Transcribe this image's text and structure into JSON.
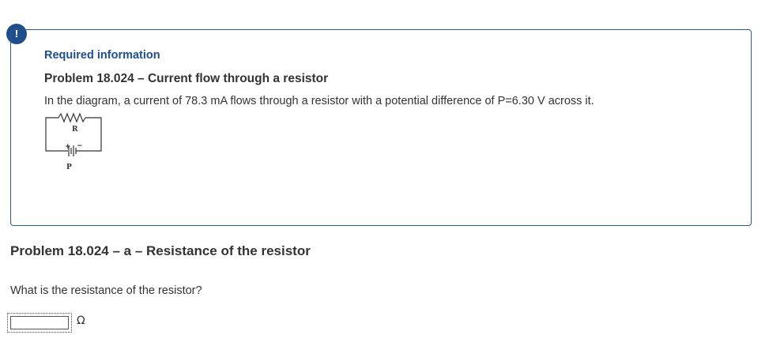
{
  "alert": {
    "icon": "exclamation-icon",
    "symbol": "!"
  },
  "info_box": {
    "heading": "Required information",
    "problem_title": "Problem 18.024 – Current flow through a resistor",
    "description": "In the diagram, a current of 78.3 mA flows through a resistor with a potential difference of  P=6.30 V across it.",
    "diagram": {
      "resistor_label": "R",
      "battery_label": "P",
      "plus_sign": "+",
      "minus_sign": "−"
    }
  },
  "part": {
    "title": "Problem 18.024 – a – Resistance of the resistor",
    "question": "What is the resistance of the resistor?",
    "answer": {
      "value": "",
      "placeholder": "",
      "unit": "Ω"
    }
  },
  "colors": {
    "accent": "#1f4e8c",
    "box_border": "#2a5a8c",
    "text": "#333333"
  }
}
